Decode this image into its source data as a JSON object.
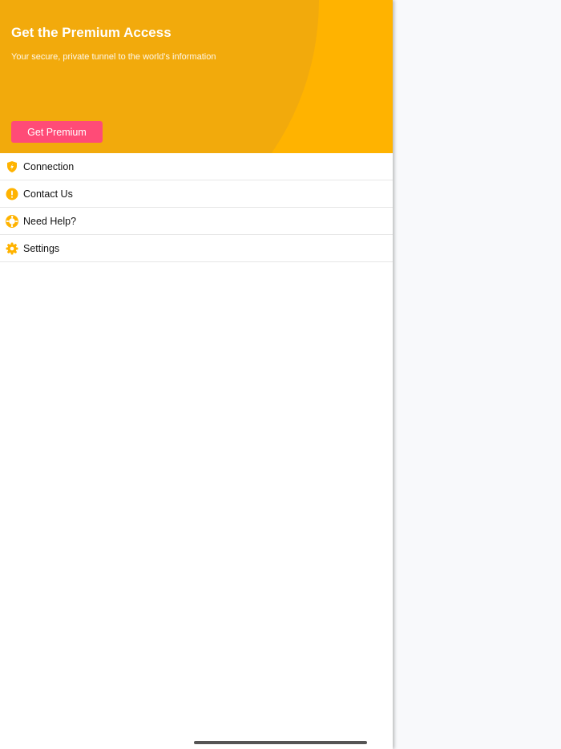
{
  "header": {
    "title": "Get the Premium Access",
    "subtitle": "Your secure, private tunnel to the world's information",
    "button": "Get Premium"
  },
  "menu": [
    {
      "label": "Connection",
      "icon": "shield-bolt-icon"
    },
    {
      "label": "Contact Us",
      "icon": "exclamation-circle-icon"
    },
    {
      "label": "Need Help?",
      "icon": "lifebuoy-icon"
    },
    {
      "label": "Settings",
      "icon": "gear-icon"
    }
  ],
  "colors": {
    "accent": "#FFB300",
    "circle": "#F2AA0C",
    "button": "#FF4B77"
  }
}
